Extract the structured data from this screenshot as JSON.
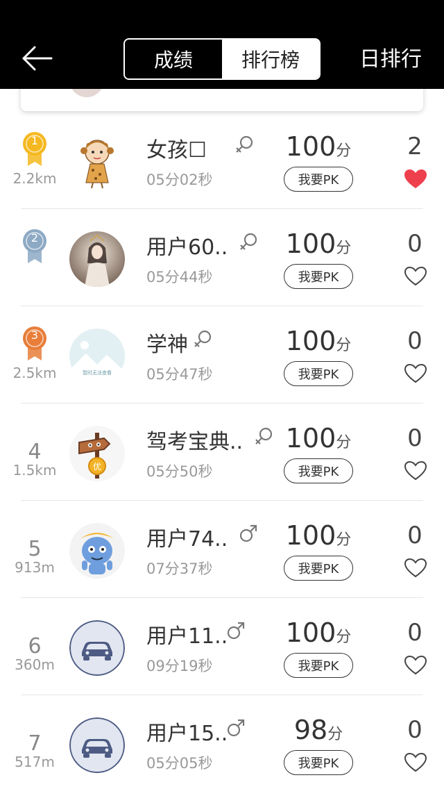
{
  "header": {
    "tabs": [
      {
        "label": "成绩",
        "active": true
      },
      {
        "label": "排行榜",
        "active": false
      }
    ],
    "right_label": "日排行"
  },
  "colors": {
    "gold": "#f5b820",
    "silver": "#8da9c4",
    "bronze": "#e87e3a",
    "heart_liked": "#ee3f4d"
  },
  "rows": [
    {
      "rank": "1",
      "medal": "gold",
      "distance": "2.2km",
      "name": "女孩☐",
      "gender": "female",
      "time": "05分02秒",
      "score": "100",
      "unit": "分",
      "pk": "我要PK",
      "likes": "2",
      "liked": true,
      "avatar": "cartoon-girl"
    },
    {
      "rank": "2",
      "medal": "silver",
      "distance": "",
      "name": "用户60..",
      "gender": "female",
      "time": "05分44秒",
      "score": "100",
      "unit": "分",
      "pk": "我要PK",
      "likes": "0",
      "liked": false,
      "avatar": "photo-woman"
    },
    {
      "rank": "3",
      "medal": "bronze",
      "distance": "2.5km",
      "name": "学神",
      "gender": "female",
      "time": "05分47秒",
      "score": "100",
      "unit": "分",
      "pk": "我要PK",
      "likes": "0",
      "liked": false,
      "avatar": "placeholder-image",
      "avatar_caption": "暂时无法查看"
    },
    {
      "rank": "4",
      "medal": "",
      "distance": "1.5km",
      "name": "驾考宝典..",
      "gender": "female",
      "time": "05分50秒",
      "score": "100",
      "unit": "分",
      "pk": "我要PK",
      "likes": "0",
      "liked": false,
      "avatar": "signpost",
      "avatar_caption": "优"
    },
    {
      "rank": "5",
      "medal": "",
      "distance": "913m",
      "name": "用户74..",
      "gender": "male",
      "time": "07分37秒",
      "score": "100",
      "unit": "分",
      "pk": "我要PK",
      "likes": "0",
      "liked": false,
      "avatar": "blue-mascot"
    },
    {
      "rank": "6",
      "medal": "",
      "distance": "360m",
      "name": "用户11..",
      "gender": "male",
      "time": "09分19秒",
      "score": "100",
      "unit": "分",
      "pk": "我要PK",
      "likes": "0",
      "liked": false,
      "avatar": "car-icon"
    },
    {
      "rank": "7",
      "medal": "",
      "distance": "517m",
      "name": "用户15..",
      "gender": "male",
      "time": "05分05秒",
      "score": "98",
      "unit": "分",
      "pk": "我要PK",
      "likes": "0",
      "liked": false,
      "avatar": "car-icon"
    }
  ]
}
